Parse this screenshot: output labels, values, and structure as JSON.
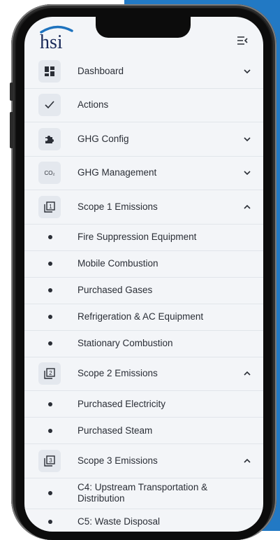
{
  "colors": {
    "accent_panel": "#2279c4",
    "logo_blue": "#1e73be",
    "text": "#2a2e36",
    "screen_bg": "#f3f5f8"
  },
  "header": {
    "logo_text": "hsi",
    "collapse_icon": "menu-collapse-icon"
  },
  "menu": {
    "dashboard": {
      "label": "Dashboard",
      "icon": "dashboard-grid-icon",
      "expanded": false
    },
    "actions": {
      "label": "Actions",
      "icon": "checkmark-icon"
    },
    "ghg_config": {
      "label": "GHG Config",
      "icon": "puzzle-icon",
      "expanded": false
    },
    "ghg_management": {
      "label": "GHG Management",
      "icon": "co2-icon",
      "icon_text": "CO₂",
      "expanded": false
    },
    "scope1": {
      "label": "Scope 1 Emissions",
      "icon": "scope-1-icon",
      "icon_text": "1",
      "expanded": true,
      "items": [
        "Fire Suppression Equipment",
        "Mobile Combustion",
        "Purchased Gases",
        "Refrigeration & AC Equipment",
        "Stationary Combustion"
      ]
    },
    "scope2": {
      "label": "Scope 2 Emissions",
      "icon": "scope-2-icon",
      "icon_text": "2",
      "expanded": true,
      "items": [
        "Purchased Electricity",
        "Purchased Steam"
      ]
    },
    "scope3": {
      "label": "Scope 3 Emissions",
      "icon": "scope-3-icon",
      "icon_text": "3",
      "expanded": true,
      "items": [
        "C4: Upstream Transportation & Distribution",
        "C5: Waste Disposal"
      ]
    }
  }
}
